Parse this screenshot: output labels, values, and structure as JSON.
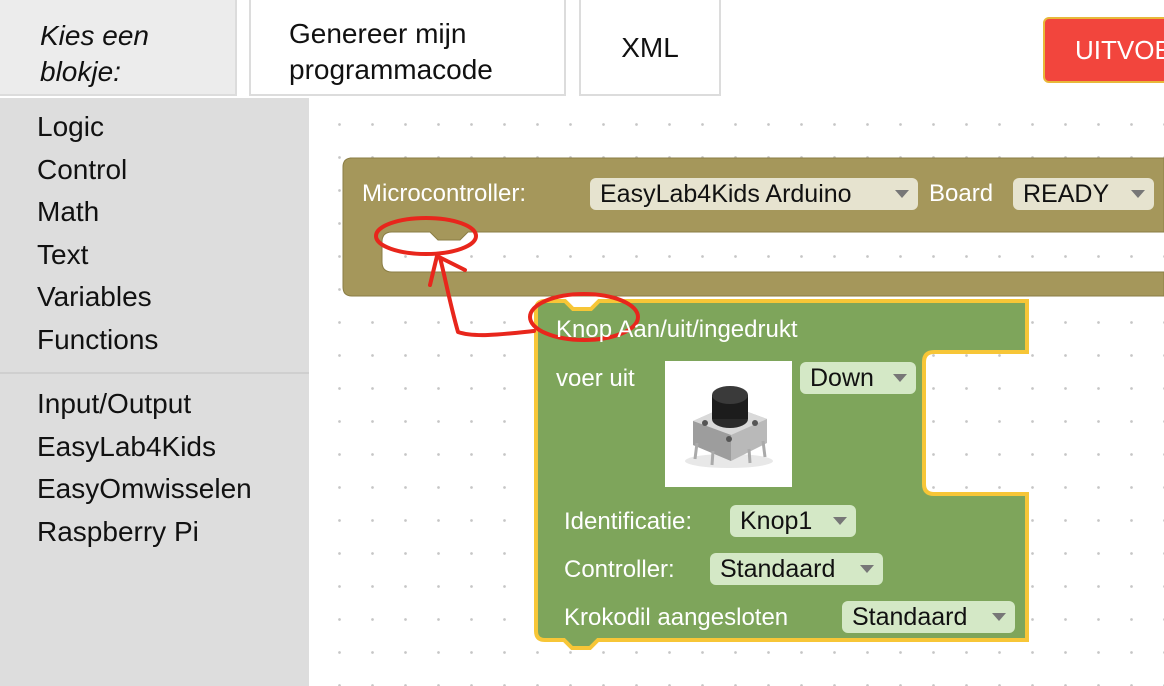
{
  "toolbar": {
    "palette_label": "Kies een blokje:",
    "code_label": "Genereer mijn programmacode",
    "xml_label": "XML",
    "run_label": "UITVOE",
    "run_color": "#f2453d"
  },
  "sidebar": {
    "categories": [
      "Logic",
      "Control",
      "Math",
      "Text",
      "Variables",
      "Functions"
    ],
    "categories2": [
      "Input/Output",
      "EasyLab4Kids",
      "EasyOmwisselen",
      "Raspberry Pi"
    ]
  },
  "microcontroller_block": {
    "label": "Microcontroller:",
    "board_value": "EasyLab4Kids Arduino",
    "board_label": "Board",
    "state_value": "READY",
    "color": "#a5975b"
  },
  "button_block": {
    "title": "Knop Aan/uit/ingedrukt",
    "do_label": "voer uit",
    "event_value": "Down",
    "id_label": "Identificatie:",
    "id_value": "Knop1",
    "controller_label": "Controller:",
    "controller_value": "Standaard",
    "clip_label": "Krokodil aangesloten",
    "clip_value": "Standaard",
    "image_icon": "push-button-image",
    "color": "#7ea55b",
    "highlight_color": "#f7c637"
  },
  "annotation": {
    "color": "#e8261c"
  }
}
